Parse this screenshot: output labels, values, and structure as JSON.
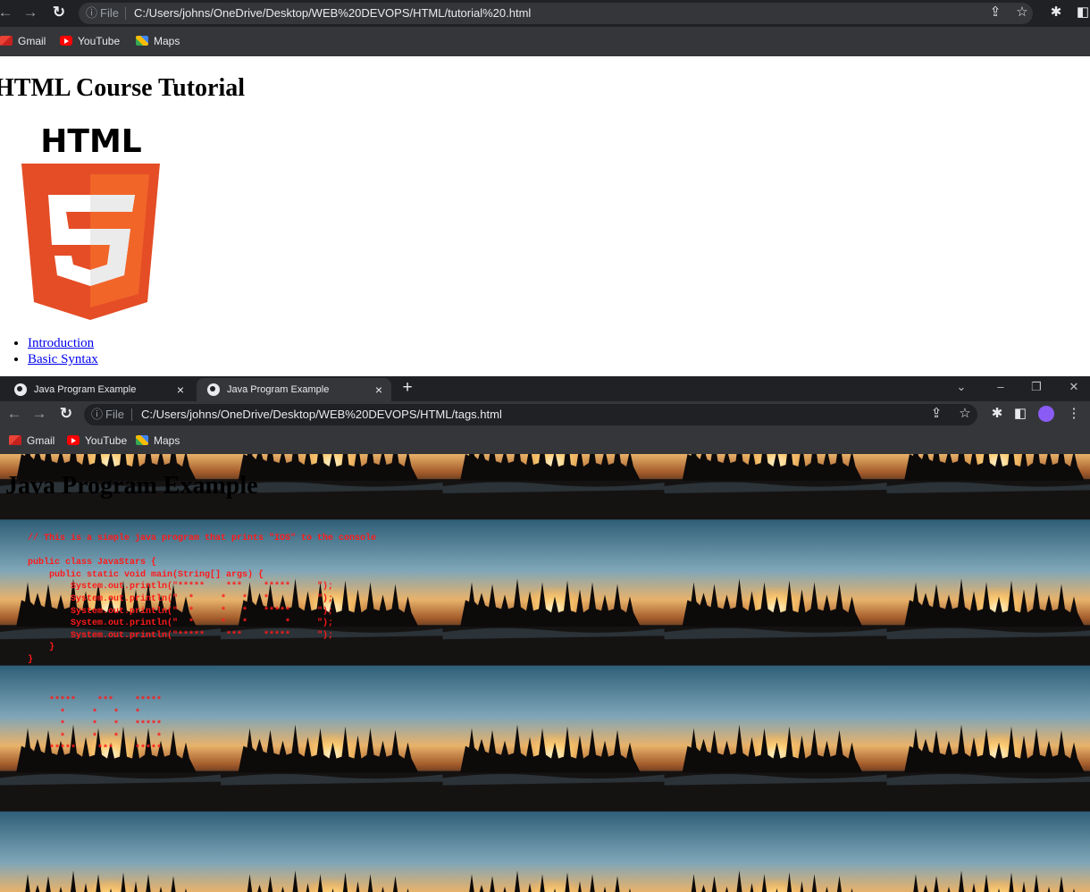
{
  "window_top": {
    "toolbar": {
      "back_icon": "arrow-left-icon",
      "forward_icon": "arrow-right-icon",
      "reload_icon": "reload-icon",
      "info_icon": "info-icon",
      "scheme_label": "File",
      "url": "C:/Users/johns/OneDrive/Desktop/WEB%20DEVOPS/HTML/tutorial%20.html",
      "share_icon": "share-icon",
      "star_icon": "star-icon",
      "extensions_icon": "puzzle-icon",
      "sidepanel_icon": "side-panel-icon"
    },
    "bookmarks": [
      {
        "label": "Gmail",
        "icon": "gmail-icon"
      },
      {
        "label": "YouTube",
        "icon": "youtube-icon"
      },
      {
        "label": "Maps",
        "icon": "maps-icon"
      }
    ],
    "page": {
      "heading": "HTML Course Tutorial",
      "logo_text": "HTML",
      "logo_colors": {
        "shield": "#e44d26",
        "shield_right": "#f16529",
        "five": "#ffffff",
        "five_shade": "#ebebeb"
      },
      "links": [
        "Introduction",
        "Basic Syntax"
      ],
      "link_color": "#0000ee"
    }
  },
  "window_bottom": {
    "tabs": [
      {
        "title": "Java Program Example",
        "active": false
      },
      {
        "title": "Java Program Example",
        "active": true
      }
    ],
    "tab_close_glyph": "×",
    "new_tab_glyph": "+",
    "window_controls": {
      "dropdown": "⌄",
      "minimize": "–",
      "restore": "❐",
      "close": "✕"
    },
    "toolbar": {
      "scheme_label": "File",
      "url": "C:/Users/johns/OneDrive/Desktop/WEB%20DEVOPS/HTML/tags.html"
    },
    "bookmarks": [
      {
        "label": "Gmail",
        "icon": "gmail-icon"
      },
      {
        "label": "YouTube",
        "icon": "youtube-icon"
      },
      {
        "label": "Maps",
        "icon": "maps-icon"
      }
    ],
    "page": {
      "heading": "Java Program Example",
      "background": "tiled sunset silhouette photo",
      "code_color": "#ff1a1a",
      "code": "// This is a simple java program that prints \"IOS\" to the console\n\npublic class JavaStars {\n    public static void main(String[] args) {\n        System.out.println(\"*****    ***    *****     \");\n        System.out.println(\"  *     *   *   *         \");\n        System.out.println(\"  *     *   *   *****     \");\n        System.out.println(\"  *     *   *       *     \");\n        System.out.println(\"*****    ***    *****     \");\n    }\n}",
      "stars_output": "*****    ***    *****\n  *     *   *   *\n  *     *   *   *****\n  *     *   *       *\n*****    ***    *****"
    }
  }
}
